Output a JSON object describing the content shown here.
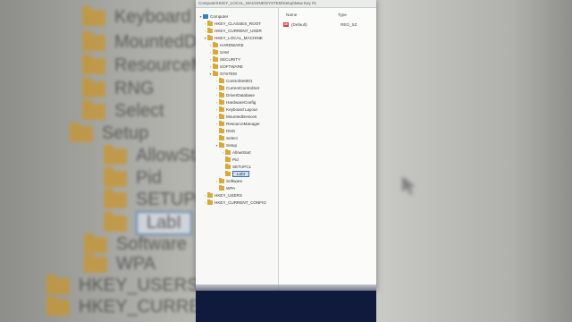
{
  "address_bar": "Computer\\HKEY_LOCAL_MACHINE\\SYSTEM\\Setup\\New Key #1",
  "tree": {
    "root": "Computer",
    "items": [
      {
        "label": "HKEY_CLASSES_ROOT"
      },
      {
        "label": "HKEY_CURRENT_USER"
      },
      {
        "label": "HKEY_LOCAL_MACHINE"
      },
      {
        "label": "HARDWARE"
      },
      {
        "label": "SAM"
      },
      {
        "label": "SECURITY"
      },
      {
        "label": "SOFTWARE"
      },
      {
        "label": "SYSTEM"
      },
      {
        "label": "ControlSet001"
      },
      {
        "label": "CurrentControlSet"
      },
      {
        "label": "DriverDatabase"
      },
      {
        "label": "HardwareConfig"
      },
      {
        "label": "Keyboard Layout"
      },
      {
        "label": "MountedDevices"
      },
      {
        "label": "ResourceManager"
      },
      {
        "label": "RNG"
      },
      {
        "label": "Select"
      },
      {
        "label": "Setup"
      },
      {
        "label": "AllowStart"
      },
      {
        "label": "Pid"
      },
      {
        "label": "SETUPCL"
      },
      {
        "label": "LabI"
      },
      {
        "label": "Software"
      },
      {
        "label": "WPA"
      },
      {
        "label": "HKEY_USERS"
      },
      {
        "label": "HKEY_CURRENT_CONFIG"
      }
    ]
  },
  "values_pane": {
    "columns": {
      "name": "Name",
      "type": "Type"
    },
    "rows": [
      {
        "name": "(Default)",
        "type": "REG_SZ",
        "icon": "ab-string-icon"
      }
    ]
  },
  "background": {
    "left_items": [
      "Keyboard La",
      "MountedDev",
      "ResourceMana",
      "RNG",
      "Select",
      "Setup",
      "AllowStart",
      "Pid",
      "SETUPCL",
      "LabI",
      "Software",
      "WPA",
      "HKEY_USERS",
      "HKEY_CURRENT_CO"
    ]
  },
  "colors": {
    "folder": "#d9a83a",
    "selection": "#cfe0f5",
    "taskbar": "#0f1a3c"
  }
}
